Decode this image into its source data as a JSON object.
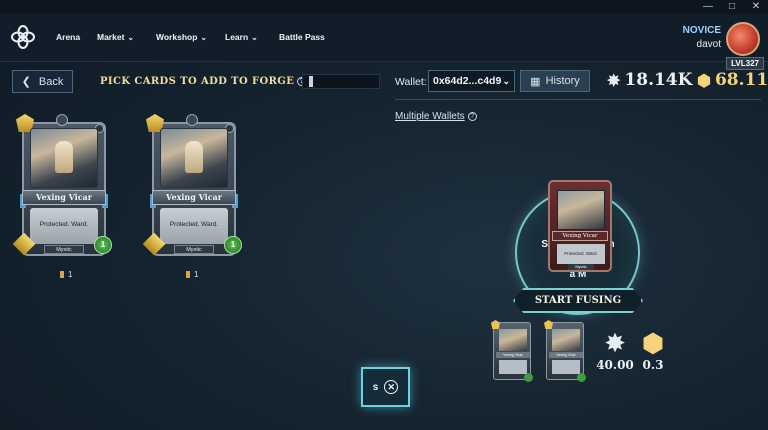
{
  "nav": {
    "items": [
      {
        "label": "Arena",
        "dropdown": false
      },
      {
        "label": "Market",
        "dropdown": true
      },
      {
        "label": "Workshop",
        "dropdown": true
      },
      {
        "label": "Learn",
        "dropdown": true
      },
      {
        "label": "Battle Pass",
        "dropdown": false
      }
    ],
    "rank": "NOVICE",
    "username": "davot",
    "level": "LVL327"
  },
  "toolbar": {
    "back_label": "Back",
    "title": "PICK CARDS TO ADD TO FORGE",
    "help": "?",
    "wallet_label": "Wallet:",
    "wallet_value": "0x64d2...c4d9",
    "history_label": "History",
    "stars": "18.14K",
    "gods": "68.11",
    "multiple_wallets": "Multiple Wallets"
  },
  "cards": [
    {
      "name": "Vexing Vicar",
      "text": "Protected. Ward.",
      "tribe": "Mystic",
      "mana": "1",
      "god": "1",
      "health": "1",
      "count": "1"
    },
    {
      "name": "Vexing Vicar",
      "text": "Protected. Ward.",
      "tribe": "Mystic",
      "mana": "1",
      "god": "1",
      "health": "1",
      "count": "1"
    }
  ],
  "forge": {
    "ring_line1": "Select 2 to gain",
    "ring_line2": "a M",
    "mini_card_name": "Vexing Vicar",
    "mini_card_text": "Protected. Ward.",
    "mini_card_tribe": "Mystic",
    "start_label": "START FUSING",
    "result_card_name": "Vexing Vicar",
    "result_stars": "40.00",
    "result_gods": "0.3"
  },
  "widget": {
    "label": "s"
  },
  "colors": {
    "accent_cyan": "#76c8cc",
    "gold": "#f4d37a",
    "background": "#152430"
  }
}
